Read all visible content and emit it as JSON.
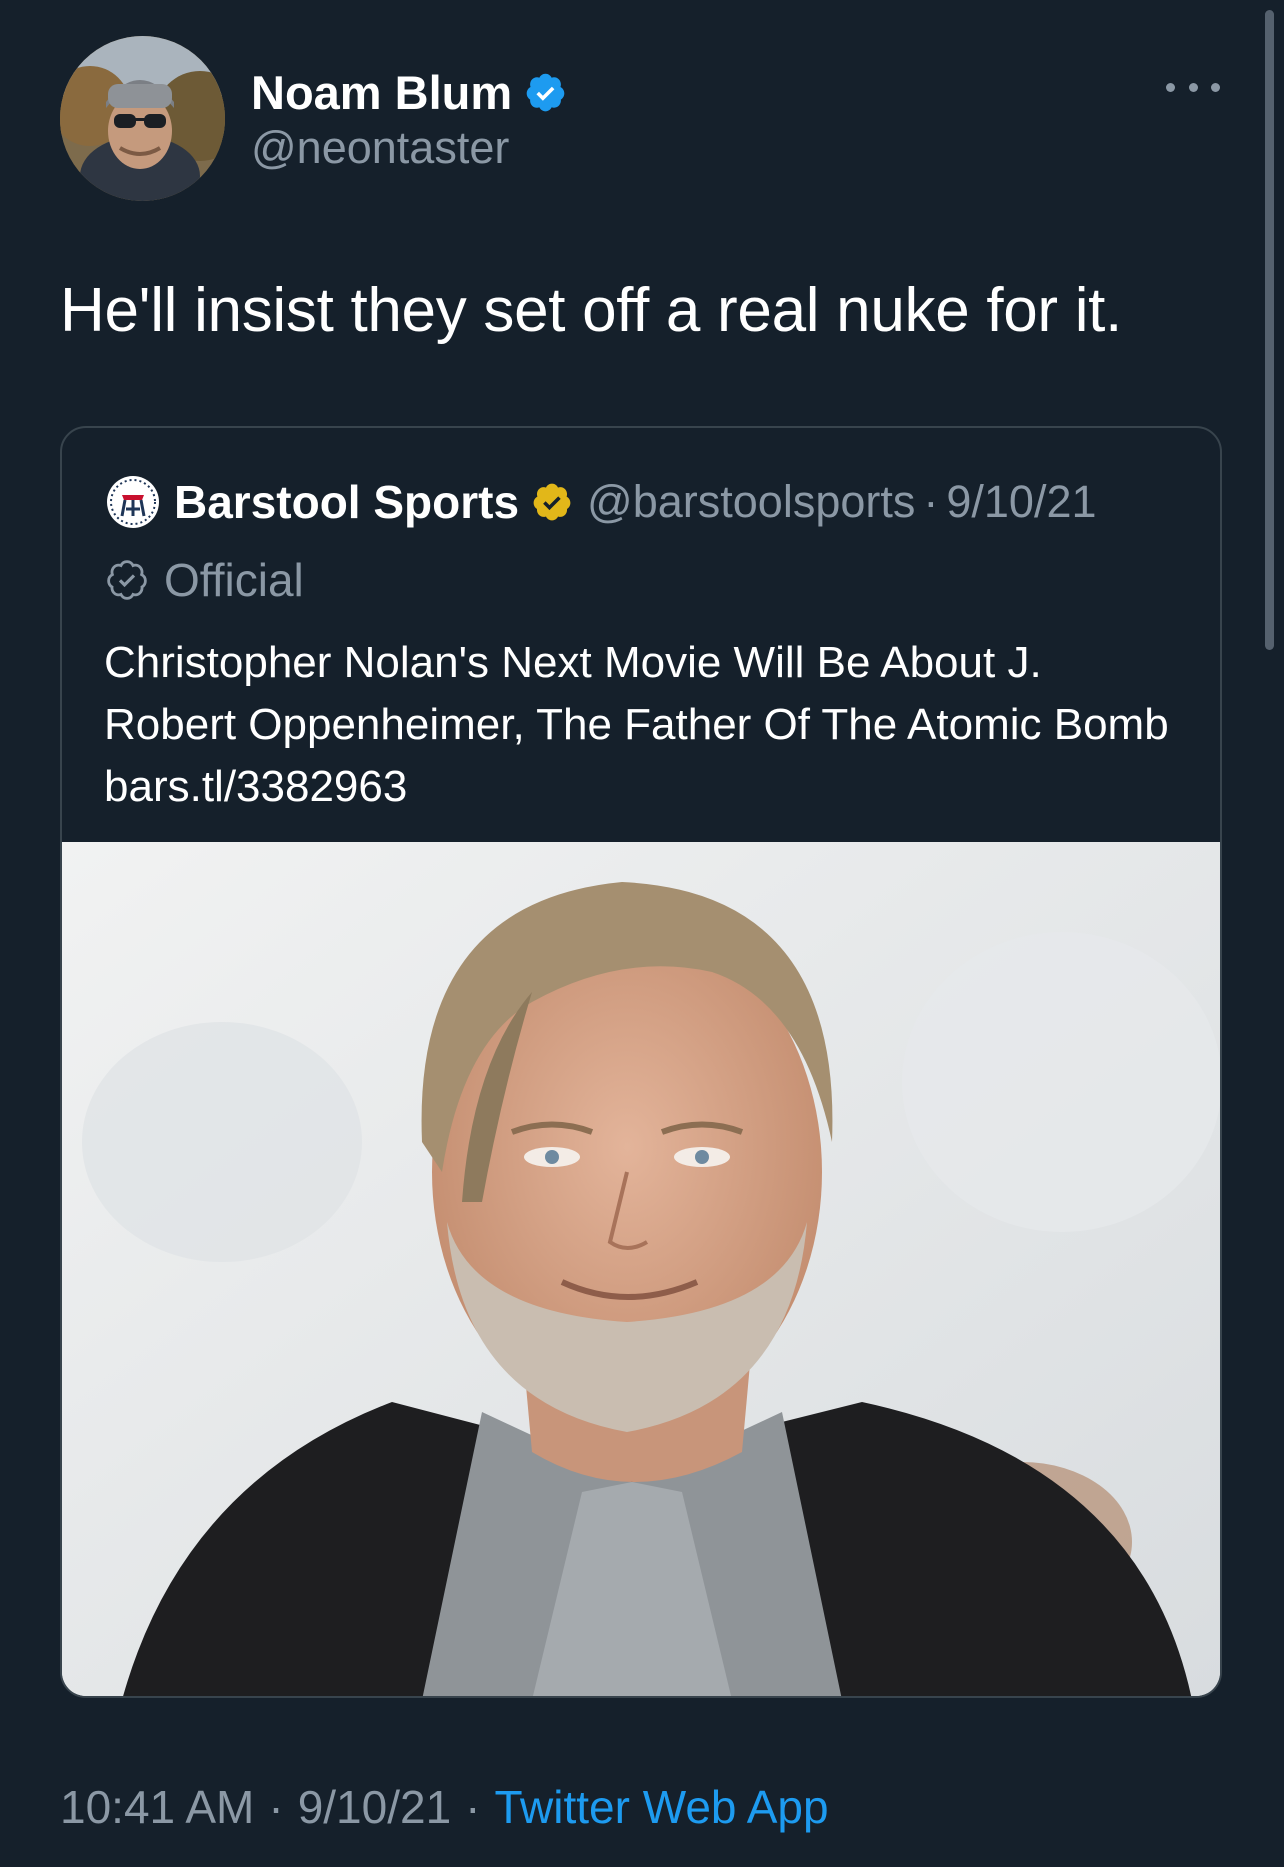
{
  "colors": {
    "background": "#15202b",
    "text_primary": "#ffffff",
    "text_secondary": "#8b98a5",
    "link": "#1d9bf0",
    "card_border": "#38444d",
    "verified_blue": "#1d9bf0",
    "verified_gold": "#e2b719"
  },
  "tweet": {
    "author": {
      "name": "Noam Blum",
      "handle": "@neontaster",
      "verified": true,
      "avatar_icon": "profile-photo"
    },
    "more_icon": "more-horizontal-icon",
    "text": "He'll insist they set off a real nuke for it.",
    "quoted": {
      "name": "Barstool Sports",
      "handle": "@barstoolsports",
      "separator": "·",
      "date": "9/10/21",
      "verified": true,
      "affiliation": "Official",
      "text": "Christopher Nolan's Next Movie Will Be About J. Robert Oppenheimer, The Father Of The Atomic Bomb bars.tl/3382963",
      "image_icon": "photo-portrait"
    },
    "meta": {
      "time": "10:41 AM",
      "separator": "·",
      "date": "9/10/21",
      "source": "Twitter Web App"
    }
  }
}
